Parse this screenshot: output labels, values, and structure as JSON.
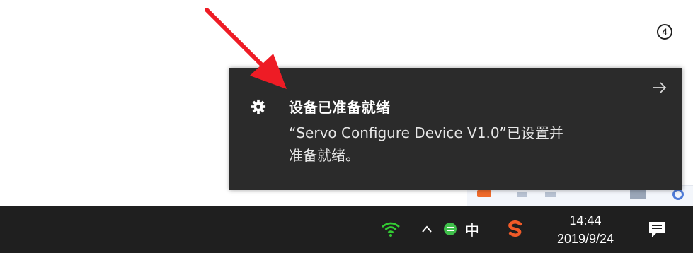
{
  "toast": {
    "title": "设备已准备就绪",
    "body_line1": "“Servo Configure Device V1.0”已设置并",
    "body_line2": "准备就绪。",
    "app_icon": "gear-icon",
    "dismiss_icon": "arrow-right-icon"
  },
  "taskbar": {
    "ime_label": "中",
    "clock_time": "14:44",
    "clock_date": "2019/9/24",
    "notification_count": "4",
    "icons": [
      "wifi-icon",
      "chevron-up-icon",
      "green-ball-icon",
      "ime-icon",
      "sogou-icon",
      "action-center-icon"
    ]
  },
  "colors": {
    "toast_bg": "#2b2b2b",
    "taskbar_bg": "#1f1f1f",
    "wifi_green": "#33cc33",
    "arrow_red": "#ee1c25",
    "sogou_orange": "#f05a28"
  }
}
